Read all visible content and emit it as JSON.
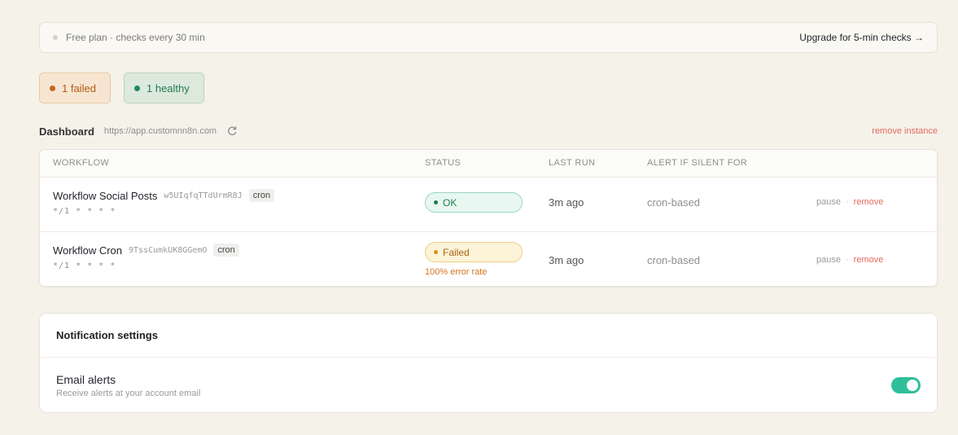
{
  "banner": {
    "plan_text": "Free plan · checks every 30 min",
    "cta": "Upgrade for 5-min checks →"
  },
  "summary": {
    "failed": "1 failed",
    "healthy": "1 healthy"
  },
  "instance": {
    "title": "Dashboard",
    "url": "https://app.customnn8n.com",
    "remove": "remove instance"
  },
  "table": {
    "headers": {
      "workflow": "WORKFLOW",
      "status": "STATUS",
      "last_run": "LAST RUN",
      "alert": "ALERT IF SILENT FOR"
    },
    "rows": [
      {
        "name": "Workflow Social Posts",
        "id": "w5UIqfqTTdUrmR8J",
        "tag": "cron",
        "cron": "*/1 * * * *",
        "status": "OK",
        "last_run": "3m ago",
        "silent": "cron-based",
        "pause": "pause",
        "sep": "·",
        "remove": "remove"
      },
      {
        "name": "Workflow Cron",
        "id": "9TssCumkUK8GGemO",
        "tag": "cron",
        "cron": "*/1 * * * *",
        "status": "Failed",
        "error_rate": "100% error rate",
        "last_run": "3m ago",
        "silent": "cron-based",
        "pause": "pause",
        "sep": "·",
        "remove": "remove"
      }
    ]
  },
  "notifications": {
    "title": "Notification settings",
    "email_label": "Email alerts",
    "email_desc": "Receive alerts at your account email",
    "email_enabled": true
  },
  "colors": {
    "background": "#f5f2ea",
    "accent": "#2ebf9a",
    "ok": "#1e7b52",
    "failed": "#c4661c",
    "danger": "#e36a5c"
  },
  "icons": {
    "refresh": "refresh-icon",
    "status_dot": "status-dot-icon"
  }
}
